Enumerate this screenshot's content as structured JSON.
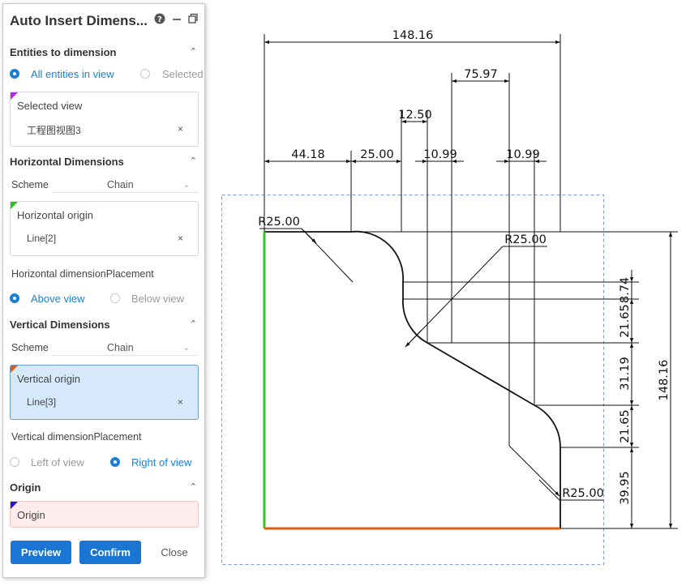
{
  "panel": {
    "title": "Auto Insert Dimens...",
    "entities": {
      "header": "Entities to dimension",
      "option_all": "All entities in view",
      "option_selected": "Selected",
      "selected_view_label": "Selected view",
      "selected_view_value": "工程图视图3",
      "remove_symbol": "×"
    },
    "horizontal": {
      "header": "Horizontal Dimensions",
      "scheme_label": "Scheme",
      "scheme_value": "Chain",
      "origin_label": "Horizontal origin",
      "origin_value": "Line[2]",
      "placement_label": "Horizontal dimensionPlacement",
      "option_above": "Above view",
      "option_below": "Below view"
    },
    "vertical": {
      "header": "Vertical Dimensions",
      "scheme_label": "Scheme",
      "scheme_value": "Chain",
      "origin_label": "Vertical origin",
      "origin_value": "Line[3]",
      "placement_label": "Vertical dimensionPlacement",
      "option_left": "Left of view",
      "option_right": "Right of view"
    },
    "origin": {
      "header": "Origin",
      "label": "Origin"
    },
    "buttons": {
      "preview": "Preview",
      "confirm": "Confirm",
      "close": "Close"
    }
  },
  "drawing": {
    "horizontal_dims": {
      "overall": "148.16",
      "d75": "75.97",
      "d12": "12.50",
      "d44": "44.18",
      "d25": "25.00",
      "d10a": "10.99",
      "d10b": "10.99"
    },
    "vertical_dims": {
      "overall": "148.16",
      "v874": "8.74",
      "v2165a": "21.65",
      "v3119": "31.19",
      "v2165b": "21.65",
      "v3995": "39.95"
    },
    "radius_labels": {
      "r1": "R25.00",
      "r2": "R25.00",
      "r3": "R25.00"
    },
    "colors": {
      "accent": "#1a76d2",
      "horizontal_origin_line": "#e25c0f",
      "vertical_origin_line": "#27d11a",
      "view_boundary": "#7a9ad8"
    }
  }
}
